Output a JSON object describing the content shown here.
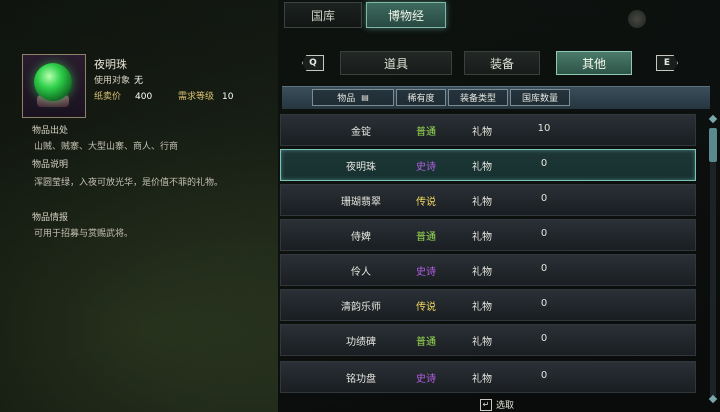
{
  "top_tabs": [
    "国库",
    "博物经"
  ],
  "item": {
    "name": "夜明珠",
    "use_target_label": "使用对象",
    "use_target_value": "无",
    "price_label": "纸卖价",
    "price_value": "400",
    "level_label": "需求等级",
    "level_value": "10"
  },
  "sections": {
    "source_title": "物品出处",
    "source_text": "山贼、贼寨、大型山寨、商人、行商",
    "desc_title": "物品说明",
    "desc_text": "浑圆莹绿，入夜可放光华，是价值不菲的礼物。",
    "info_title": "物品情报",
    "info_text": "可用于招募与赏赐武将。"
  },
  "sub_tabs": [
    "道具",
    "装备",
    "其他"
  ],
  "nav": {
    "prev": "Q",
    "next": "E"
  },
  "columns": [
    "物品",
    "稀有度",
    "装备类型",
    "国库数量"
  ],
  "rows": [
    {
      "name": "金锭",
      "rarity": "普通",
      "type": "礼物",
      "count": "10"
    },
    {
      "name": "夜明珠",
      "rarity": "史诗",
      "type": "礼物",
      "count": "0"
    },
    {
      "name": "珊瑚翡翠",
      "rarity": "传说",
      "type": "礼物",
      "count": "0"
    },
    {
      "name": "侍婢",
      "rarity": "普通",
      "type": "礼物",
      "count": "0"
    },
    {
      "name": "伶人",
      "rarity": "史诗",
      "type": "礼物",
      "count": "0"
    },
    {
      "name": "清韵乐师",
      "rarity": "传说",
      "type": "礼物",
      "count": "0"
    },
    {
      "name": "功绩碑",
      "rarity": "普通",
      "type": "礼物",
      "count": "0"
    },
    {
      "name": "铭功盘",
      "rarity": "史诗",
      "type": "礼物",
      "count": "0"
    }
  ],
  "rarity_colors": {
    "普通": "#9bdc52",
    "史诗": "#b45fe6",
    "传说": "#f0d860"
  },
  "footer": {
    "key": "↵",
    "label": "选取"
  }
}
